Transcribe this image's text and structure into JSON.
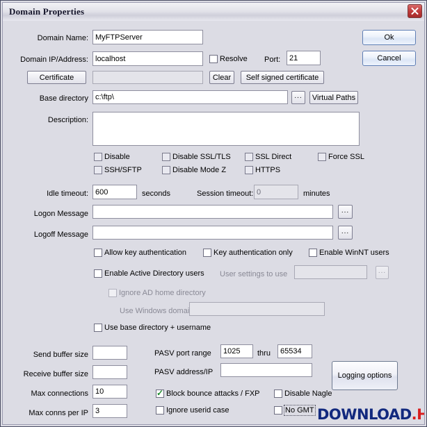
{
  "window": {
    "title": "Domain Properties",
    "close_icon": "close-icon"
  },
  "buttons": {
    "ok": "Ok",
    "cancel": "Cancel",
    "certificate": "Certificate",
    "clear": "Clear",
    "self_signed": "Self signed certificate",
    "browse_dots": "...",
    "virtual_paths": "Virtual Paths",
    "logging_options": "Logging options"
  },
  "fields": {
    "domain_name": {
      "label": "Domain Name:",
      "value": "MyFTPServer"
    },
    "domain_ip": {
      "label": "Domain IP/Address:",
      "value": "localhost"
    },
    "port": {
      "label": "Port:",
      "value": "21"
    },
    "certificate_path": {
      "value": ""
    },
    "base_directory": {
      "label": "Base directory",
      "value": "c:\\ftp\\"
    },
    "description": {
      "label": "Description:",
      "value": ""
    },
    "idle_timeout": {
      "label": "Idle timeout:",
      "value": "600",
      "units": "seconds"
    },
    "session_timeout": {
      "label": "Session timeout:",
      "value": "0",
      "units": "minutes"
    },
    "logon_message": {
      "label": "Logon Message",
      "value": ""
    },
    "logoff_message": {
      "label": "Logoff Message",
      "value": ""
    },
    "user_settings_to_use": {
      "label": "User settings to use",
      "value": ""
    },
    "use_windows_domain": {
      "label": "Use Windows domain:",
      "value": ""
    },
    "send_buffer_size": {
      "label": "Send buffer size",
      "value": ""
    },
    "receive_buffer_size": {
      "label": "Receive buffer size",
      "value": ""
    },
    "max_connections": {
      "label": "Max connections",
      "value": "10"
    },
    "max_conns_per_ip": {
      "label": "Max conns per IP",
      "value": "3"
    },
    "pasv_port_range": {
      "label": "PASV port range",
      "from": "1025",
      "thru": "thru",
      "to": "65534"
    },
    "pasv_address_ip": {
      "label": "PASV address/IP",
      "value": ""
    }
  },
  "checkboxes": {
    "resolve": {
      "label": "Resolve",
      "checked": false
    },
    "disable": {
      "label": "Disable",
      "checked": false
    },
    "disable_ssl_tls": {
      "label": "Disable SSL/TLS",
      "checked": false
    },
    "ssl_direct": {
      "label": "SSL Direct",
      "checked": false
    },
    "force_ssl": {
      "label": "Force SSL",
      "checked": false
    },
    "ssh_sftp": {
      "label": "SSH/SFTP",
      "checked": false
    },
    "disable_mode_z": {
      "label": "Disable Mode Z",
      "checked": false
    },
    "https": {
      "label": "HTTPS",
      "checked": false
    },
    "allow_key_auth": {
      "label": "Allow key authentication",
      "checked": false
    },
    "key_auth_only": {
      "label": "Key authentication only",
      "checked": false
    },
    "enable_winnt_users": {
      "label": "Enable WinNT users",
      "checked": false
    },
    "enable_ad_users": {
      "label": "Enable Active Directory users",
      "checked": false
    },
    "ignore_ad_home": {
      "label": "Ignore AD home directory",
      "checked": false
    },
    "use_base_dir_username": {
      "label": "Use base directory + username",
      "checked": false
    },
    "block_bounce": {
      "label": "Block bounce attacks / FXP",
      "checked": true
    },
    "disable_nagle": {
      "label": "Disable Nagle",
      "checked": false
    },
    "ignore_userid_case": {
      "label": "Ignore userid case",
      "checked": false
    },
    "no_gmt": {
      "label": "No GMT",
      "checked": false
    }
  },
  "watermark": {
    "primary": "DOWNLOAD",
    "suffix": ".HR"
  },
  "colors": {
    "window_bg": "#dcdce4",
    "border": "#4a4d63",
    "check_green": "#1d8b2c",
    "watermark_blue": "#12297e",
    "watermark_red": "#d81f1f"
  }
}
